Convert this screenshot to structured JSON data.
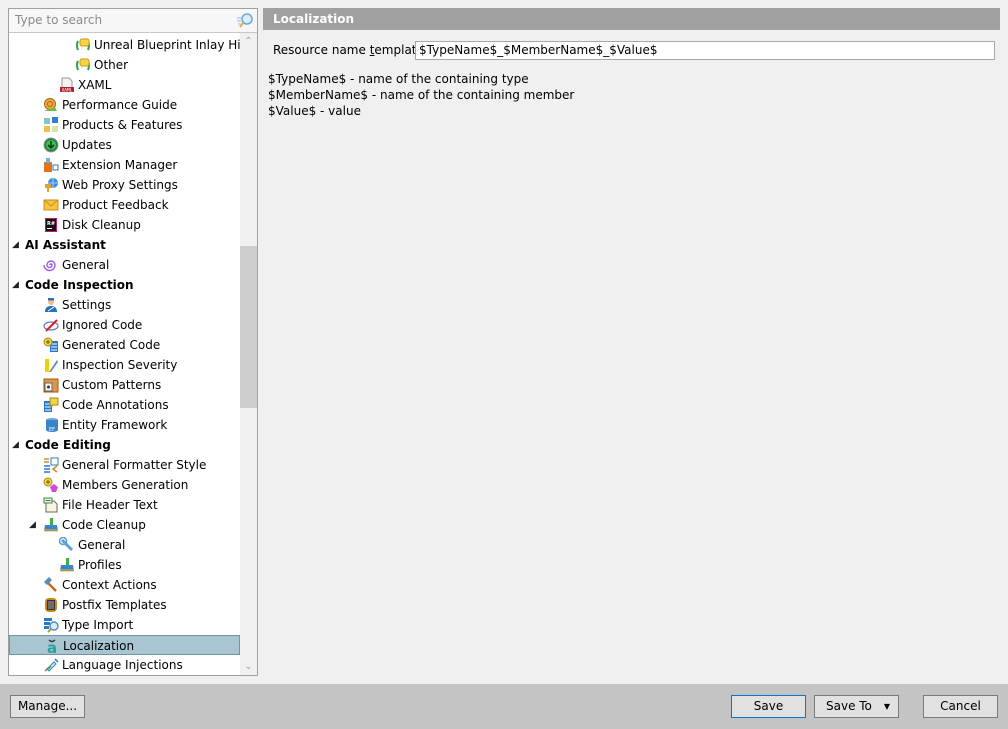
{
  "search": {
    "placeholder": "Type to search"
  },
  "tree": {
    "items": [
      {
        "label": "Unreal Blueprint Inlay Hints",
        "icon": "inlay-hints-icon",
        "level": 3
      },
      {
        "label": "Other",
        "icon": "inlay-hints-icon",
        "level": 3
      },
      {
        "label": "XAML",
        "icon": "xaml-file-icon",
        "level": 2
      },
      {
        "label": "Performance Guide",
        "icon": "snail-icon",
        "level": 1
      },
      {
        "label": "Products & Features",
        "icon": "products-grid-icon",
        "level": 1
      },
      {
        "label": "Updates",
        "icon": "download-arrow-icon",
        "level": 1
      },
      {
        "label": "Extension Manager",
        "icon": "extension-manager-icon",
        "level": 1
      },
      {
        "label": "Web Proxy Settings",
        "icon": "web-proxy-icon",
        "level": 1
      },
      {
        "label": "Product Feedback",
        "icon": "envelope-icon",
        "level": 1
      },
      {
        "label": "Disk Cleanup",
        "icon": "resharper-icon",
        "level": 1
      },
      {
        "label": "AI Assistant",
        "icon": "",
        "level": 0,
        "group": true
      },
      {
        "label": "General",
        "icon": "ai-spiral-icon",
        "level": 1
      },
      {
        "label": "Code Inspection",
        "icon": "",
        "level": 0,
        "group": true
      },
      {
        "label": "Settings",
        "icon": "inspector-icon",
        "level": 1
      },
      {
        "label": "Ignored Code",
        "icon": "ignored-code-icon",
        "level": 1
      },
      {
        "label": "Generated Code",
        "icon": "generated-code-icon",
        "level": 1
      },
      {
        "label": "Inspection Severity",
        "icon": "severity-icon",
        "level": 1
      },
      {
        "label": "Custom Patterns",
        "icon": "custom-patterns-icon",
        "level": 1
      },
      {
        "label": "Code Annotations",
        "icon": "code-annotations-icon",
        "level": 1
      },
      {
        "label": "Entity Framework",
        "icon": "entity-framework-icon",
        "level": 1
      },
      {
        "label": "Code Editing",
        "icon": "",
        "level": 0,
        "group": true
      },
      {
        "label": "General Formatter Style",
        "icon": "formatter-icon",
        "level": 1
      },
      {
        "label": "Members Generation",
        "icon": "members-generation-icon",
        "level": 1
      },
      {
        "label": "File Header Text",
        "icon": "file-header-icon",
        "level": 1
      },
      {
        "label": "Code Cleanup",
        "icon": "broom-icon",
        "level": 1,
        "expanded": true
      },
      {
        "label": "General",
        "icon": "wrench-icon",
        "level": 2
      },
      {
        "label": "Profiles",
        "icon": "broom-icon",
        "level": 2
      },
      {
        "label": "Context Actions",
        "icon": "hammer-icon",
        "level": 1
      },
      {
        "label": "Postfix Templates",
        "icon": "postfix-templates-icon",
        "level": 1
      },
      {
        "label": "Type Import",
        "icon": "type-import-icon",
        "level": 1
      },
      {
        "label": "Localization",
        "icon": "localization-icon",
        "level": 1,
        "selected": true
      },
      {
        "label": "Language Injections",
        "icon": "syringe-icon",
        "level": 1
      }
    ]
  },
  "content": {
    "title": "Localization",
    "field_label_pre": "Resource name ",
    "field_label_mnemonic": "t",
    "field_label_post": "emplate:",
    "field_value": "$TypeName$_$MemberName$_$Value$",
    "help": [
      "$TypeName$ - name of the containing type",
      "$MemberName$ - name of the containing member",
      "$Value$ - value"
    ]
  },
  "footer": {
    "manage_label": "Manage...",
    "save_label": "Save",
    "save_to_label": "Save To",
    "cancel_label": "Cancel"
  },
  "colors": {
    "header_bg": "#a0a0a0",
    "selection_bg": "#a8c5d1",
    "default_button_border": "#0078d7",
    "footer_bg": "#c4c4c4"
  }
}
